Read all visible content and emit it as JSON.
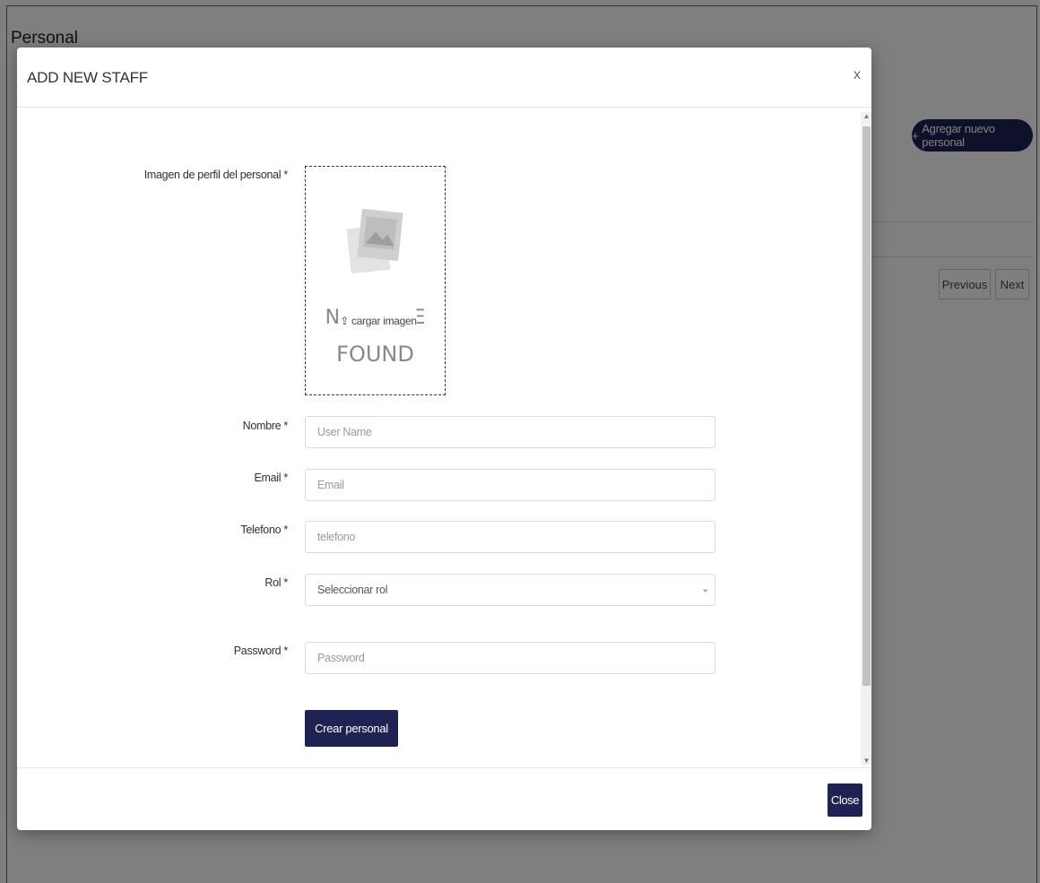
{
  "background": {
    "page_title": "Personal",
    "add_button_label": "Agregar nuevo personal",
    "pagination": {
      "previous": "Previous",
      "next": "Next"
    }
  },
  "modal": {
    "title": "ADD NEW STAFF",
    "close_x": "x",
    "image_field": {
      "label": "Imagen de perfil del personal *",
      "upload_label": "cargar imagen",
      "placeholder_text_top": "NO IMAGE",
      "placeholder_text_bottom": "FOUND"
    },
    "fields": {
      "nombre": {
        "label": "Nombre *",
        "placeholder": "User Name"
      },
      "email": {
        "label": "Email *",
        "placeholder": "Email"
      },
      "telefono": {
        "label": "Telefono *",
        "placeholder": "telefono"
      },
      "rol": {
        "label": "Rol *",
        "selected": "Seleccionar rol"
      },
      "password": {
        "label": "Password *",
        "placeholder": "Password"
      }
    },
    "submit_label": "Crear personal",
    "footer_close_label": "Close"
  },
  "colors": {
    "primary": "#1f2354",
    "overlay": "rgba(0,0,0,0.5)"
  }
}
